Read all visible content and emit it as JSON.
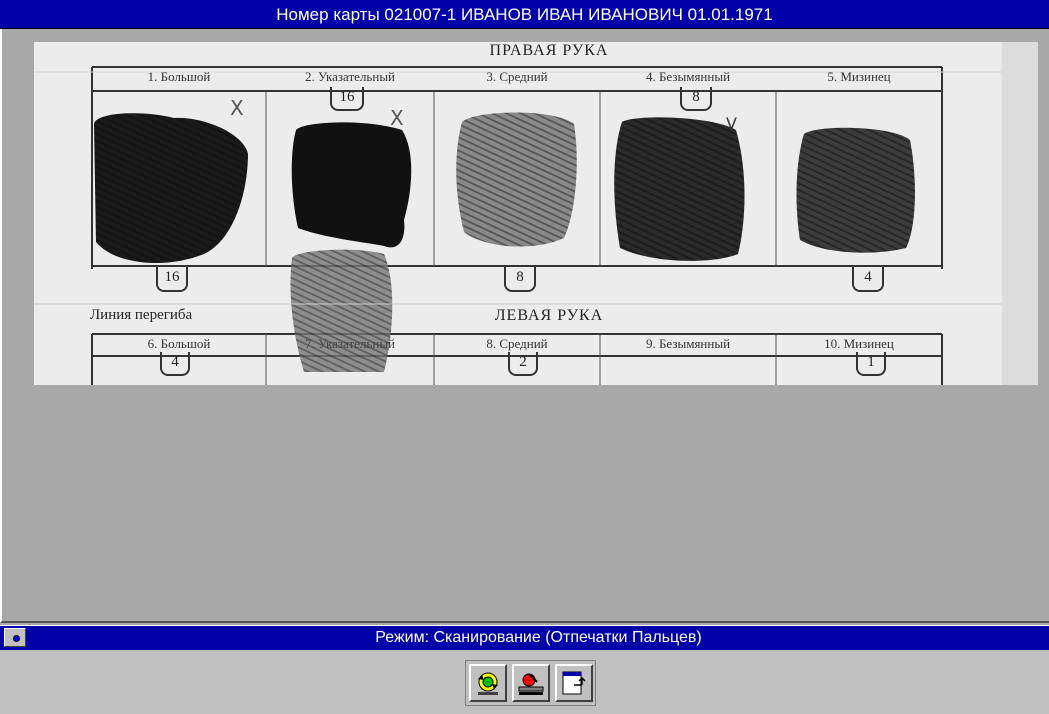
{
  "window": {
    "title": "Номер карты 021007-1  ИВАНОВ ИВАН ИВАНОВИЧ  01.01.1971"
  },
  "card": {
    "right_hand_title": "ПРАВАЯ РУКА",
    "left_hand_title": "ЛЕВАЯ РУКА",
    "fold_line_label": "Линия перегиба",
    "right_fingers": [
      {
        "label": "1. Большой",
        "top_code": "",
        "bottom_code": "16",
        "mark": "Х"
      },
      {
        "label": "2. Указательный",
        "top_code": "16",
        "bottom_code": "",
        "mark": "Х"
      },
      {
        "label": "3. Средний",
        "top_code": "",
        "bottom_code": "8",
        "mark": ""
      },
      {
        "label": "4. Безымянный",
        "top_code": "8",
        "bottom_code": "",
        "mark": "V"
      },
      {
        "label": "5. Мизинец",
        "top_code": "",
        "bottom_code": "4",
        "mark": ""
      }
    ],
    "left_fingers": [
      {
        "label": "6. Большой",
        "top_code": "4"
      },
      {
        "label": "7. Указательный",
        "top_code": ""
      },
      {
        "label": "8. Средний",
        "top_code": "2"
      },
      {
        "label": "9. Безымянный",
        "top_code": ""
      },
      {
        "label": "10. Мизинец",
        "top_code": "1"
      }
    ]
  },
  "status": {
    "mode_text": "Режим: Сканирование  (Отпечатки Пальцев)"
  },
  "toolbar": {
    "buttons": [
      {
        "name": "rotate-scan-button",
        "icon": "rotate-scan-icon"
      },
      {
        "name": "scanner-button",
        "icon": "scanner-icon"
      },
      {
        "name": "exit-window-button",
        "icon": "window-exit-icon"
      }
    ]
  },
  "colors": {
    "title_bar": "#0000a8",
    "workspace": "#a8a8a8",
    "button_face": "#c0c0c0"
  }
}
